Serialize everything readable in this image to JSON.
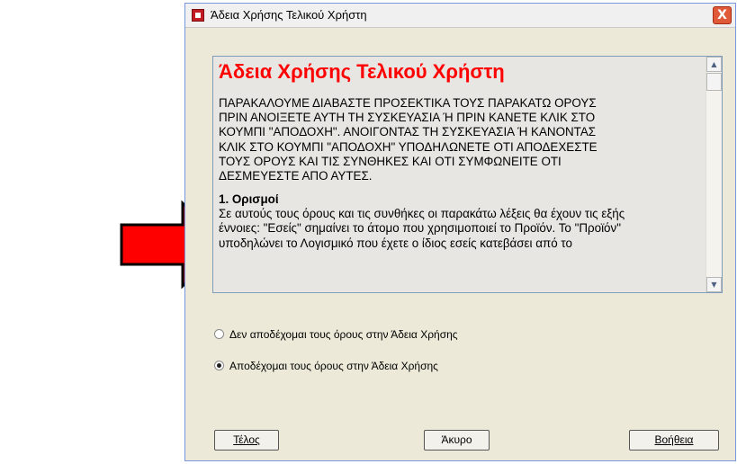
{
  "window": {
    "title": "Άδεια Χρήσης Τελικού Χρήστη",
    "close_symbol": "X"
  },
  "license": {
    "heading": "Άδεια Χρήσης Τελικού Χρήστη",
    "intro_lines": [
      "ΠΑΡΑΚΑΛΟΥΜΕ ΔΙΑΒΑΣΤΕ ΠΡΟΣΕΚΤΙΚΑ ΤΟΥΣ ΠΑΡΑΚΑΤΩ ΟΡΟΥΣ",
      "ΠΡΙΝ ΑΝΟΙΞΕΤΕ ΑΥΤΗ ΤΗ ΣΥΣΚΕΥΑΣΙΑ Ή ΠΡΙΝ ΚΑΝΕΤΕ ΚΛΙΚ ΣΤΟ",
      "ΚΟΥΜΠΙ \"ΑΠΟΔΟΧΗ\". ΑΝΟΙΓΟΝΤΑΣ ΤΗ ΣΥΣΚΕΥΑΣΙΑ Ή ΚΑΝΟΝΤΑΣ",
      "ΚΛΙΚ ΣΤΟ ΚΟΥΜΠΙ \"ΑΠΟΔΟΧΗ\" ΥΠΟΔΗΛΩΝΕΤΕ ΟΤΙ ΑΠΟΔΕΧΕΣΤΕ",
      "ΤΟΥΣ ΟΡΟΥΣ ΚΑΙ ΤΙΣ ΣΥΝΘΗΚΕΣ ΚΑΙ ΟΤΙ ΣΥΜΦΩΝΕΙΤΕ ΟΤΙ",
      "ΔΕΣΜΕΥΕΣΤΕ ΑΠΟ ΑΥΤΕΣ."
    ],
    "section_title": "1. Ορισμοί",
    "section_lines": [
      "Σε αυτούς τους όρους και τις συνθήκες οι παρακάτω λέξεις θα έχουν τις εξής",
      "έννοιες: \"Εσείς\" σημαίνει το άτομο που χρησιμοποιεί το Προϊόν. Το \"Προϊόν\"",
      "υποδηλώνει το Λογισμικό που έχετε ο ίδιος εσείς κατεβάσει από το"
    ],
    "scroll_up_symbol": "▲",
    "scroll_down_symbol": "▼"
  },
  "options": [
    {
      "label": "Δεν αποδέχομαι τους όρους στην Άδεια Χρήσης",
      "selected": false
    },
    {
      "label": "Αποδέχομαι τους όρους στην Άδεια Χρήσης",
      "selected": true
    }
  ],
  "buttons": {
    "finish": "Τέλος",
    "cancel": "Άκυρο",
    "help": "Βοήθεια"
  },
  "colors": {
    "arrow": "#ff0000",
    "heading": "#ff0000",
    "close_button": "#e05a3a"
  },
  "icons": {
    "window_icon": "app-icon",
    "indicator": "right-arrow-icon"
  }
}
